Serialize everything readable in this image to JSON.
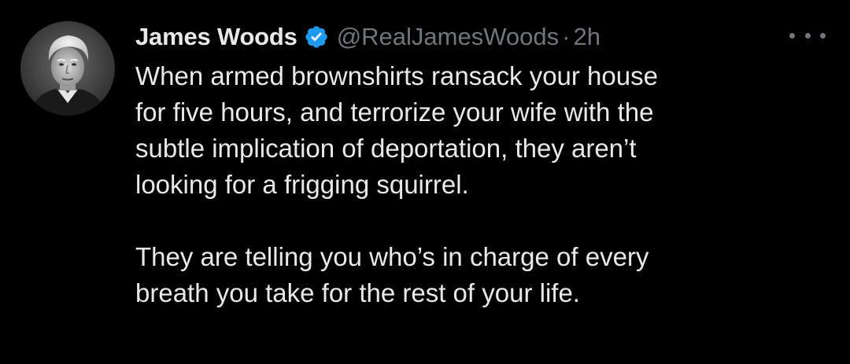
{
  "tweet": {
    "author": {
      "display_name": "James Woods",
      "handle": "@RealJamesWoods",
      "verified": true,
      "avatar_icon": "profile-photo"
    },
    "separator": "·",
    "timestamp": "2h",
    "more_icon": "more-options-icon",
    "text_paragraphs": [
      "When armed brownshirts ransack your house\nfor five hours, and terrorize your wife with the\nsubtle implication of deportation, they aren’t\nlooking for a frigging squirrel.",
      "They are telling you who’s in charge of every\nbreath you take for the rest of your life."
    ]
  },
  "colors": {
    "background": "#000000",
    "primary_text": "#e7e9ea",
    "secondary_text": "#71767b",
    "verified_badge": "#1d9bf0"
  }
}
